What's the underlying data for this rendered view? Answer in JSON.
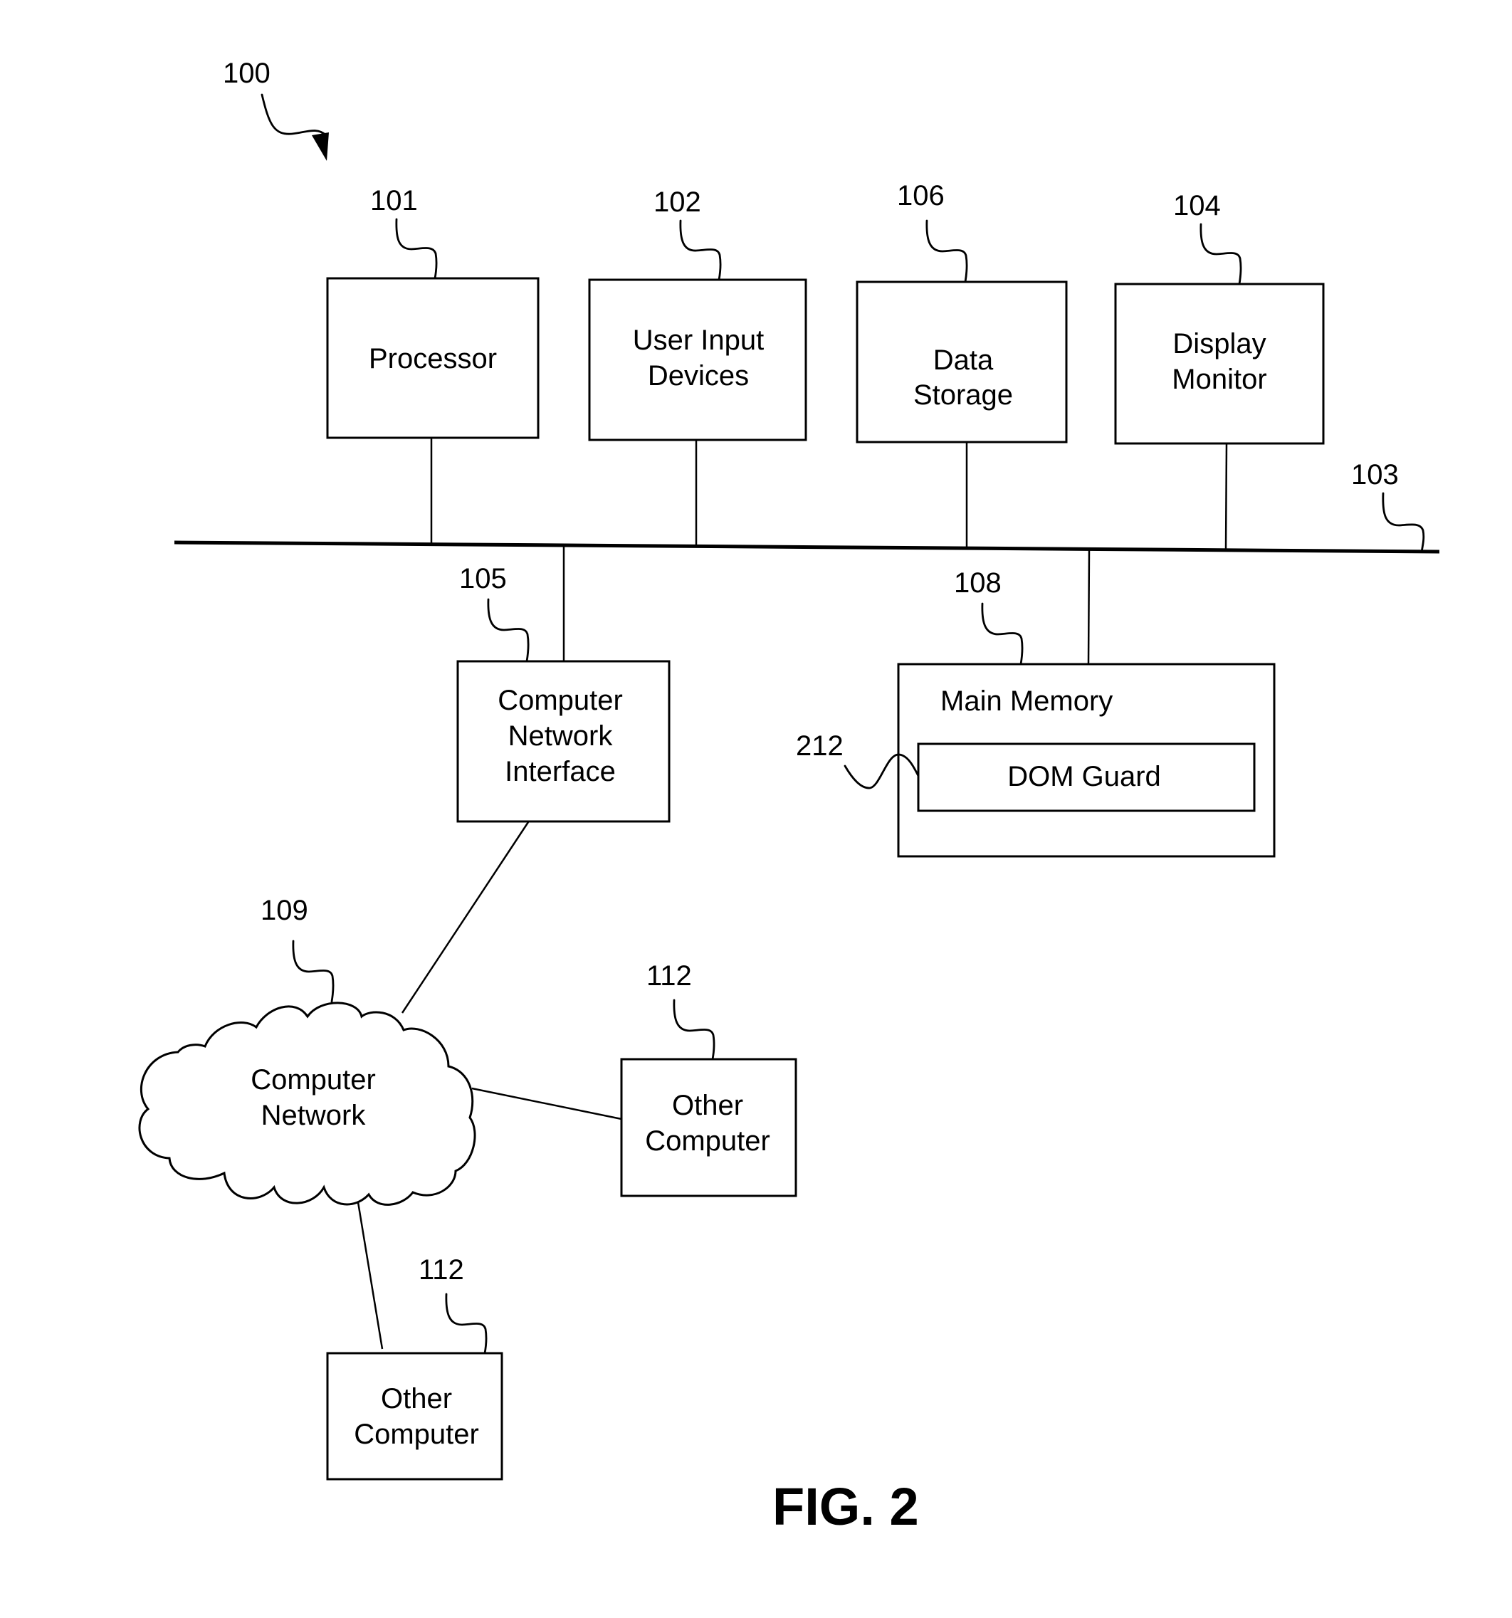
{
  "figure": {
    "title": "FIG. 2",
    "system_ref": "100"
  },
  "components": {
    "processor": {
      "ref": "101",
      "lines": [
        "Processor"
      ]
    },
    "user_input": {
      "ref": "102",
      "lines": [
        "User Input",
        "Devices"
      ]
    },
    "data_storage": {
      "ref": "106",
      "lines": [
        "Data",
        "Storage"
      ]
    },
    "display_monitor": {
      "ref": "104",
      "lines": [
        "Display",
        "Monitor"
      ]
    },
    "bus": {
      "ref": "103"
    },
    "network_interface": {
      "ref": "105",
      "lines": [
        "Computer",
        "Network",
        "Interface"
      ]
    },
    "main_memory": {
      "ref": "108",
      "lines": [
        "Main Memory"
      ]
    },
    "dom_guard": {
      "ref": "212",
      "lines": [
        "DOM Guard"
      ]
    },
    "computer_network": {
      "ref": "109",
      "lines": [
        "Computer",
        "Network"
      ]
    },
    "other_computer_1": {
      "ref": "112",
      "lines": [
        "Other",
        "Computer"
      ]
    },
    "other_computer_2": {
      "ref": "112",
      "lines": [
        "Other",
        "Computer"
      ]
    }
  }
}
